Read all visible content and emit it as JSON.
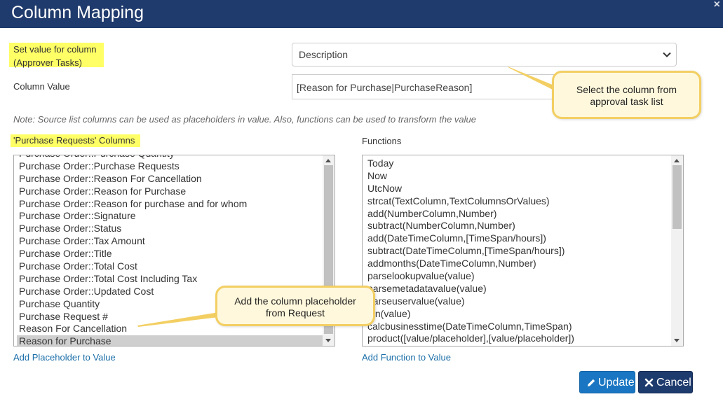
{
  "dialog": {
    "title": "Column Mapping",
    "close_label": "×"
  },
  "form": {
    "set_value_label_line1": "Set value for column",
    "set_value_label_line2": "(Approver Tasks)",
    "column_select_value": "Description",
    "column_value_label": "Column Value",
    "column_value_input": "[Reason for Purchase|PurchaseReason]",
    "note": "Note: Source list columns can be used as placeholders in value. Also, functions can be used to transform the value"
  },
  "source_columns": {
    "label": "'Purchase Requests' Columns",
    "items": [
      "Purchase Order::Purchase Quantity",
      "Purchase Order::Purchase Requests",
      "Purchase Order::Reason For Cancellation",
      "Purchase Order::Reason for Purchase",
      "Purchase Order::Reason for purchase and for whom",
      "Purchase Order::Signature",
      "Purchase Order::Status",
      "Purchase Order::Tax Amount",
      "Purchase Order::Title",
      "Purchase Order::Total Cost",
      "Purchase Order::Total Cost Including Tax",
      "Purchase Order::Updated Cost",
      "Purchase Quantity",
      "Purchase Request #",
      "Reason For Cancellation",
      "Reason for Purchase"
    ],
    "selected_index": 15,
    "add_link": "Add Placeholder to Value",
    "scroll_thumb": {
      "start_fraction": 0.0,
      "visible_fraction": 0.98
    }
  },
  "functions": {
    "label": "Functions",
    "items": [
      "Today",
      "Now",
      "UtcNow",
      "strcat(TextColumn,TextColumnsOrValues)",
      "add(NumberColumn,Number)",
      "subtract(NumberColumn,Number)",
      "add(DateTimeColumn,[TimeSpan/hours])",
      "subtract(DateTimeColumn,[TimeSpan/hours])",
      "addmonths(DateTimeColumn,Number)",
      "parselookupvalue(value)",
      "parsemetadatavalue(value)",
      "parseuservalue(value)",
      "len(value)",
      "calcbusinesstime(DateTimeColumn,TimeSpan)",
      "product([value/placeholder],[value/placeholder])"
    ],
    "add_link": "Add Function to Value",
    "scroll_thumb": {
      "start_fraction": 0.0,
      "visible_fraction": 0.37
    }
  },
  "buttons": {
    "update": "Update",
    "cancel": "Cancel"
  },
  "callouts": {
    "select_column_line1": "Select the column from",
    "select_column_line2": "approval task list",
    "add_placeholder_line1": "Add the column placeholder",
    "add_placeholder_line2": "from Request"
  },
  "colors": {
    "title_bar": "#1f3a6c",
    "highlight": "#ffff66",
    "link": "#1a6ea8",
    "update_button": "#1a76c2",
    "cancel_button": "#1e3b6e",
    "callout_fill": "#fff8dc",
    "callout_border": "#f3cf63"
  },
  "icons": {
    "update": "pencil-icon",
    "cancel": "x-icon",
    "select": "chevron-down-icon"
  }
}
